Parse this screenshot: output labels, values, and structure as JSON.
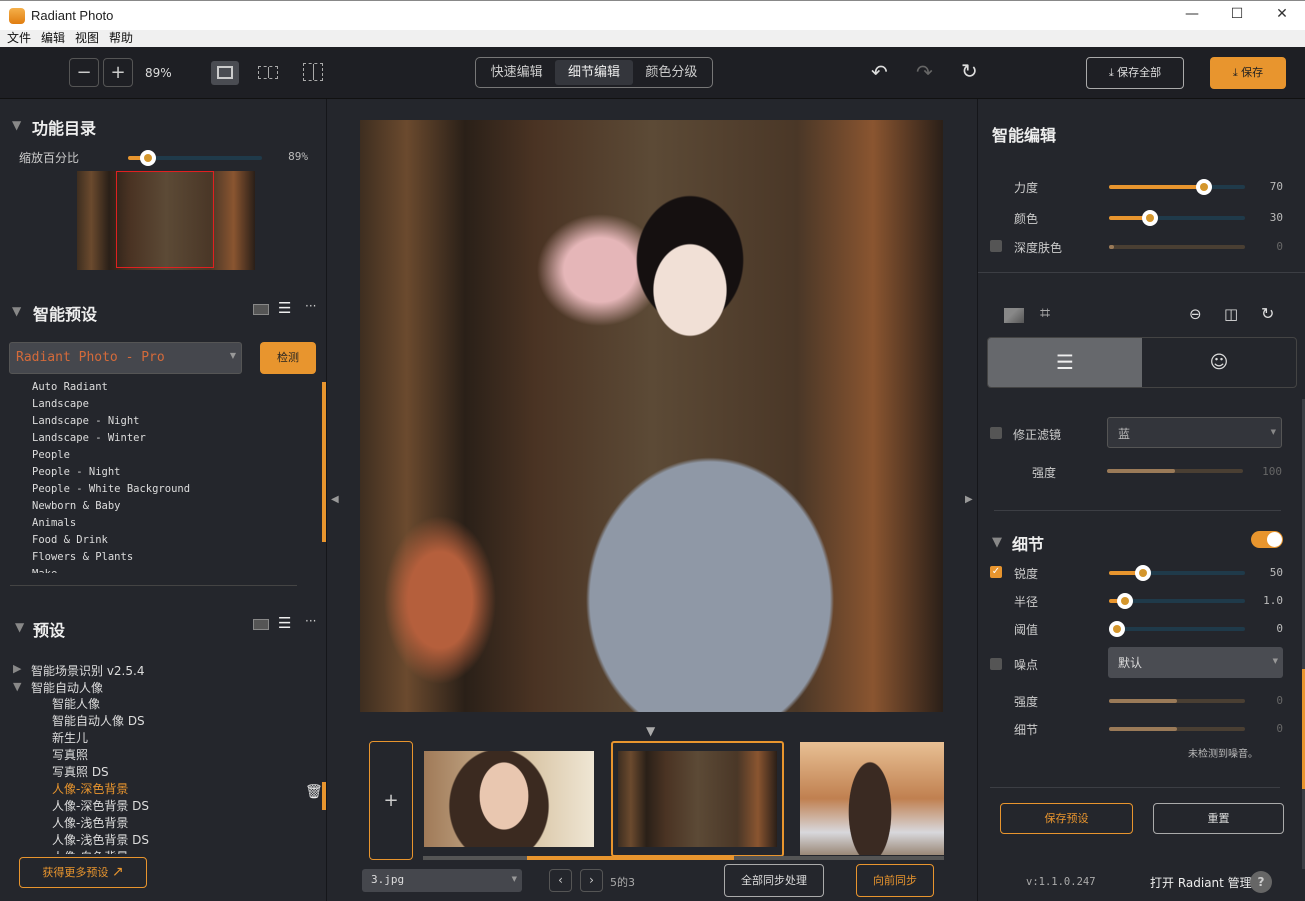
{
  "app": {
    "title": "Radiant Photo",
    "window_controls": [
      "—",
      "☐",
      "✕"
    ]
  },
  "menu": [
    "文件",
    "编辑",
    "视图",
    "帮助"
  ],
  "toolbar": {
    "zoom_out": "−",
    "zoom_in": "+",
    "zoom_level": "89%",
    "modes": [
      "快速编辑",
      "细节编辑",
      "颜色分级"
    ],
    "active_mode": "细节编辑",
    "save_all": "保存全部",
    "save": "保存"
  },
  "catalog": {
    "title": "功能目录",
    "zoom_label": "缩放百分比",
    "zoom_value": "89%",
    "zoom_percent": 89
  },
  "smart_presets": {
    "title": "智能预设",
    "selected": "Radiant Photo - Pro",
    "detect": "检测",
    "items": [
      "Auto Radiant",
      "Landscape",
      "Landscape - Night",
      "Landscape - Winter",
      "People",
      "People - Night",
      "People - White Background",
      "Newborn & Baby",
      "Animals",
      "Food & Drink",
      "Flowers & Plants",
      "Make..."
    ]
  },
  "presets": {
    "title": "预设",
    "groups": [
      {
        "label": "智能场景识别 v2.5.4",
        "expanded": false
      },
      {
        "label": "智能自动人像",
        "expanded": true
      }
    ],
    "items": [
      "智能人像",
      "智能自动人像 DS",
      "新生儿",
      "写真照",
      "写真照 DS",
      "人像-深色背景",
      "人像-深色背景 DS",
      "人像-浅色背景",
      "人像-浅色背景 DS",
      "人像-白色背景"
    ],
    "selected": "人像-深色背景",
    "get_more": "获得更多预设"
  },
  "filmstrip": {
    "add": "+",
    "file": "3.jpg",
    "counter": "5的3",
    "sync_all": "全部同步处理",
    "sync_forward": "向前同步"
  },
  "smart_edit": {
    "title": "智能编辑",
    "sliders": [
      {
        "label": "力度",
        "value": "70",
        "pct": 70,
        "checkbox": false
      },
      {
        "label": "颜色",
        "value": "30",
        "pct": 30,
        "checkbox": false
      },
      {
        "label": "深度肤色",
        "value": "0",
        "pct": 0,
        "checkbox": true,
        "checked": false
      }
    ]
  },
  "filter": {
    "label": "修正滤镜",
    "option": "蓝",
    "strength_label": "强度",
    "strength": "100",
    "pct": 50
  },
  "detail": {
    "title": "细节",
    "enabled": true,
    "sharpen": {
      "label": "锐度",
      "value": "50",
      "pct": 25,
      "checked": true
    },
    "radius": {
      "label": "半径",
      "value": "1.0",
      "pct": 12
    },
    "threshold": {
      "label": "阈值",
      "value": "0",
      "pct": 0
    },
    "noise": {
      "label": "噪点",
      "option": "默认",
      "checked": false
    },
    "noise_strength": {
      "label": "强度",
      "value": "0",
      "pct": 50
    },
    "noise_detail": {
      "label": "细节",
      "value": "0",
      "pct": 50
    },
    "noise_msg": "未检测到噪音。"
  },
  "footer": {
    "save_preset": "保存预设",
    "reset": "重置",
    "version": "v:1.1.0.247",
    "open_manager": "打开 Radiant 管理",
    "help": "?"
  },
  "colors": {
    "accent": "#e8952e",
    "bg": "#24262c"
  }
}
